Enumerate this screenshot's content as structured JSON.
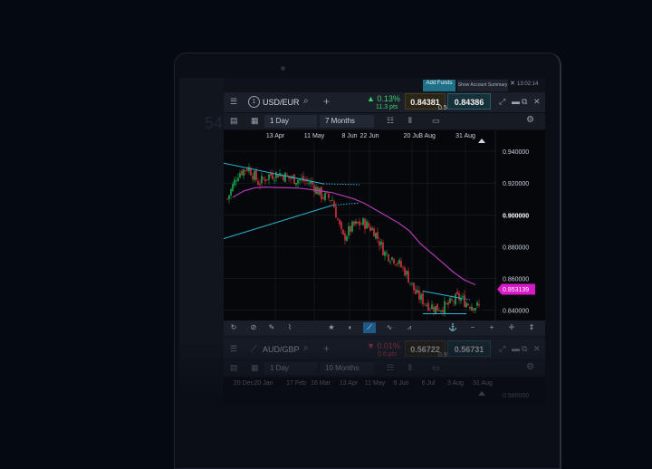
{
  "ghost": {
    "text": "54"
  },
  "top_strip": {
    "add_funds": "Add Funds",
    "summary": "Show Account Summary",
    "close": "✕",
    "clock": "13:02:14"
  },
  "instruments": [
    {
      "symbol": "USD/EUR",
      "change_pct": "▲ 0.13%",
      "change_pts": "11.3 pts",
      "sell": "0.84381",
      "buy": "0.84386",
      "spread": "0.5",
      "interval": "1 Day",
      "range": "7 Months",
      "direction": "up"
    },
    {
      "symbol": "AUD/GBP",
      "change_pct": "▼ 0.01%",
      "change_pts": "0.6 pts",
      "sell": "0.56722",
      "buy": "0.56731",
      "spread": "0.9",
      "interval": "1 Day",
      "range": "10 Months",
      "direction": "down"
    }
  ],
  "chart_data": {
    "type": "line",
    "subtype": "candlestick",
    "title": "",
    "x_ticks": [
      "13 Apr",
      "11 May",
      "8 Jun",
      "22 Jun",
      "20 Jul",
      "3 Aug",
      "31 Aug"
    ],
    "y_ticks": [
      "0.940000",
      "0.920000",
      "0.900000",
      "0.880000",
      "0.860000",
      "0.840000"
    ],
    "ylim": [
      0.8335,
      0.9463
    ],
    "current_price_label": "0.853139",
    "series": [
      {
        "name": "",
        "type": "moving-average",
        "color": "#b23bb6",
        "values": [
          0.911,
          0.915,
          0.917,
          0.9175,
          0.9172,
          0.917,
          0.9168,
          0.916,
          0.915,
          0.914,
          0.912,
          0.91,
          0.907,
          0.903,
          0.899,
          0.895,
          0.89,
          0.882,
          0.876,
          0.87,
          0.864,
          0.859,
          0.856
        ]
      }
    ],
    "close_values": [
      0.91,
      0.926,
      0.93,
      0.92,
      0.925,
      0.926,
      0.923,
      0.922,
      0.92,
      0.912,
      0.91,
      0.885,
      0.893,
      0.895,
      0.89,
      0.876,
      0.872,
      0.864,
      0.85,
      0.844,
      0.841,
      0.843,
      0.848,
      0.844,
      0.842
    ],
    "colors": {
      "up": "#1fa84f",
      "down": "#d6333e",
      "trendline": "#2bb6d3",
      "price_tag": "#d819c8"
    },
    "grid": true
  },
  "chart2_data": {
    "x_ticks": [
      "20 Dec",
      "20 Jan",
      "17 Feb",
      "16 Mar",
      "13 Apr",
      "11 May",
      "8 Jun",
      "6 Jul",
      "3 Aug",
      "31 Aug"
    ],
    "y_ticks": [
      "0.580000"
    ]
  }
}
